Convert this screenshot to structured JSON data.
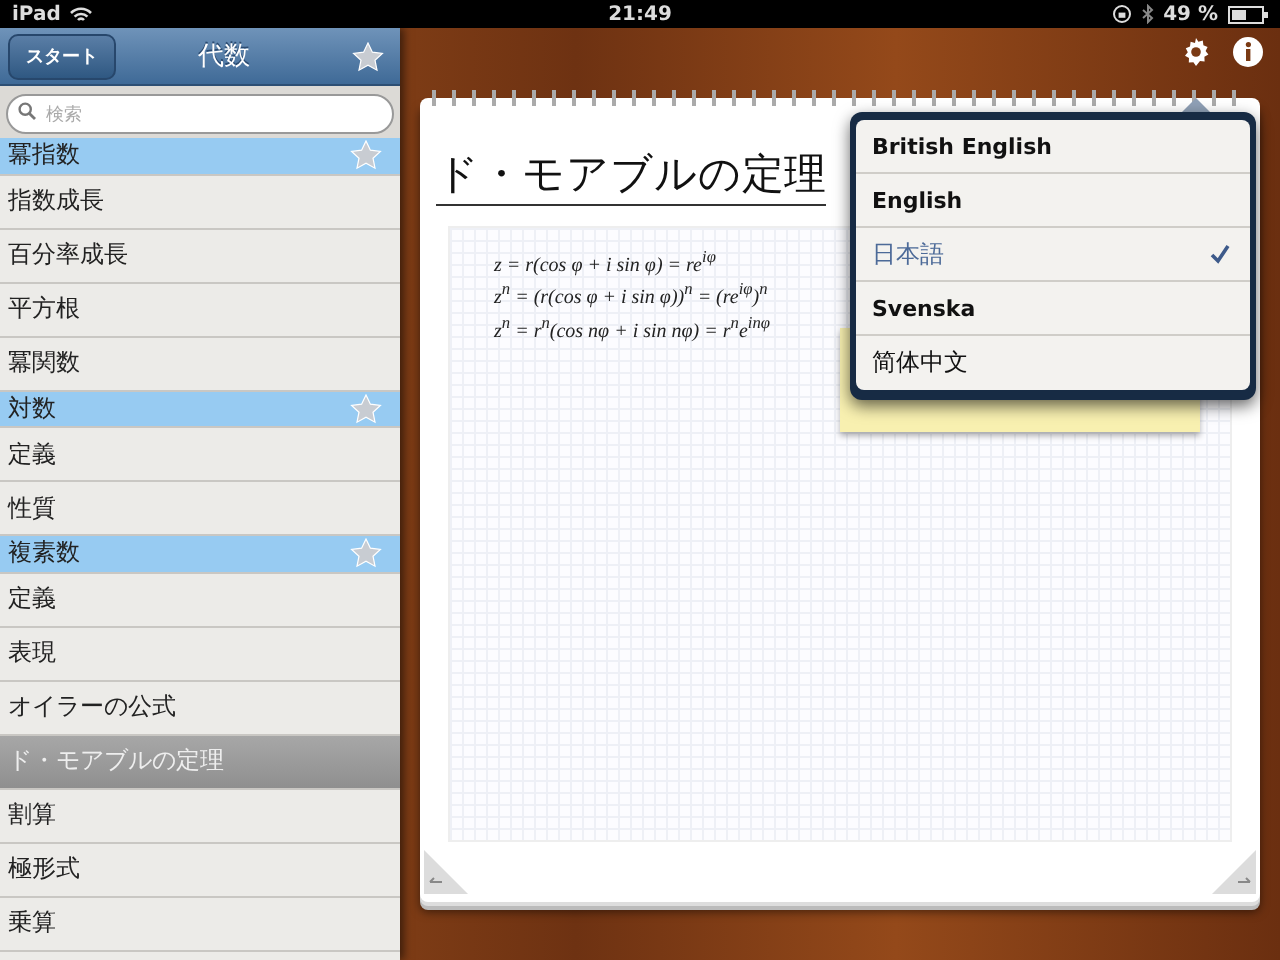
{
  "status_bar": {
    "device": "iPad",
    "time": "21:49",
    "battery": "49 %"
  },
  "sidebar": {
    "back_button": "スタート",
    "title": "代数",
    "search": {
      "placeholder": "検索"
    },
    "items": [
      {
        "kind": "header",
        "label": "冪指数",
        "selected": false
      },
      {
        "kind": "item",
        "label": "指数成長",
        "selected": false
      },
      {
        "kind": "item",
        "label": "百分率成長",
        "selected": false
      },
      {
        "kind": "item",
        "label": "平方根",
        "selected": false
      },
      {
        "kind": "item",
        "label": "冪関数",
        "selected": false
      },
      {
        "kind": "header",
        "label": "対数",
        "selected": false
      },
      {
        "kind": "item",
        "label": "定義",
        "selected": false
      },
      {
        "kind": "item",
        "label": "性質",
        "selected": false
      },
      {
        "kind": "header",
        "label": "複素数",
        "selected": false
      },
      {
        "kind": "item",
        "label": "定義",
        "selected": false
      },
      {
        "kind": "item",
        "label": "表現",
        "selected": false
      },
      {
        "kind": "item",
        "label": "オイラーの公式",
        "selected": false
      },
      {
        "kind": "item",
        "label": "ド・モアブルの定理",
        "selected": true
      },
      {
        "kind": "item",
        "label": "割算",
        "selected": false
      },
      {
        "kind": "item",
        "label": "極形式",
        "selected": false
      },
      {
        "kind": "item",
        "label": "乗算",
        "selected": false
      }
    ]
  },
  "page": {
    "title": "ド・モアブルの定理",
    "formulas": [
      "z = r(cos φ + i sin φ) = re$^{iφ}$",
      "z$^{n}$ = (r(cos φ + i sin φ))$^{n}$ = (re$^{iφ}$)$^{n}$",
      "z$^{n}$ = r$^{n}$(cos nφ + i sin nφ) = r$^{n}$e$^{inφ}$"
    ]
  },
  "language_menu": {
    "options": [
      {
        "label": "British English",
        "selected": false
      },
      {
        "label": "English",
        "selected": false
      },
      {
        "label": "日本語",
        "selected": true
      },
      {
        "label": "Svenska",
        "selected": false
      },
      {
        "label": "简体中文",
        "selected": false
      }
    ]
  }
}
